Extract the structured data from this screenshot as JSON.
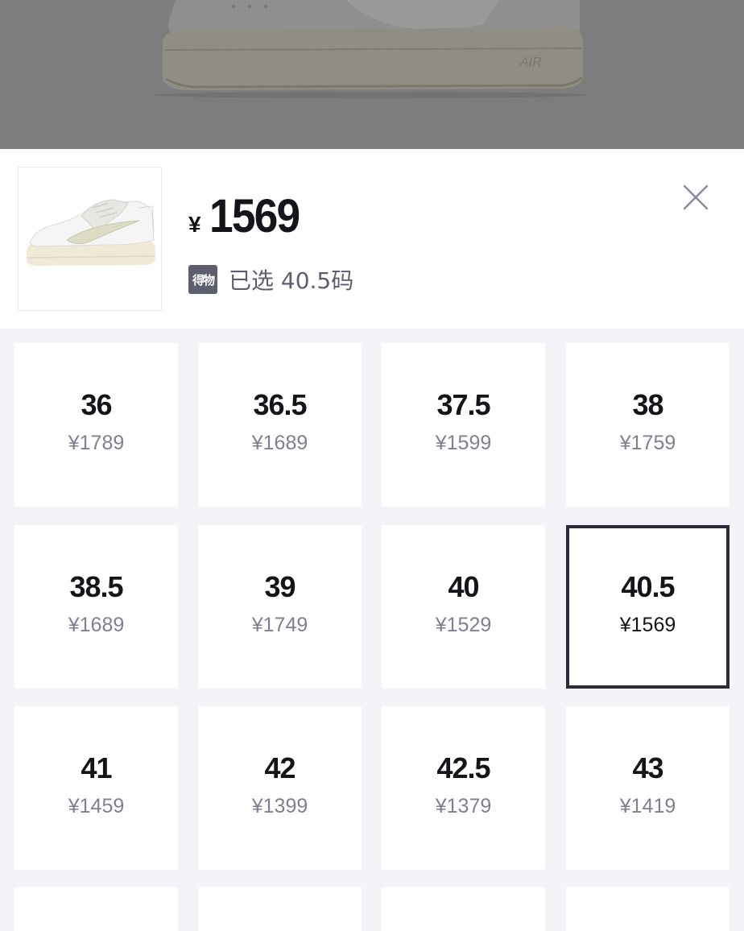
{
  "header": {
    "price_symbol": "¥",
    "price": "1569",
    "brand_badge": "得物",
    "selected_text": "已选 40.5码"
  },
  "sizes": [
    {
      "size": "36",
      "price": "¥1789",
      "selected": false
    },
    {
      "size": "36.5",
      "price": "¥1689",
      "selected": false
    },
    {
      "size": "37.5",
      "price": "¥1599",
      "selected": false
    },
    {
      "size": "38",
      "price": "¥1759",
      "selected": false
    },
    {
      "size": "38.5",
      "price": "¥1689",
      "selected": false
    },
    {
      "size": "39",
      "price": "¥1749",
      "selected": false
    },
    {
      "size": "40",
      "price": "¥1529",
      "selected": false
    },
    {
      "size": "40.5",
      "price": "¥1569",
      "selected": true
    },
    {
      "size": "41",
      "price": "¥1459",
      "selected": false
    },
    {
      "size": "42",
      "price": "¥1399",
      "selected": false
    },
    {
      "size": "42.5",
      "price": "¥1379",
      "selected": false
    },
    {
      "size": "43",
      "price": "¥1419",
      "selected": false
    },
    {
      "size": "",
      "price": "",
      "selected": false
    },
    {
      "size": "",
      "price": "",
      "selected": false
    },
    {
      "size": "",
      "price": "",
      "selected": false
    },
    {
      "size": "",
      "price": "",
      "selected": false
    }
  ],
  "colors": {
    "overlay": "#7d7d7d",
    "sheet_bg": "#f4f4f8",
    "text_primary": "#14151a",
    "text_secondary": "#7f8191",
    "selected_border": "#2b2b3b",
    "badge_bg": "#5d5f6f"
  },
  "icons": {
    "close": "close-icon",
    "brand": "brand-badge-icon"
  }
}
